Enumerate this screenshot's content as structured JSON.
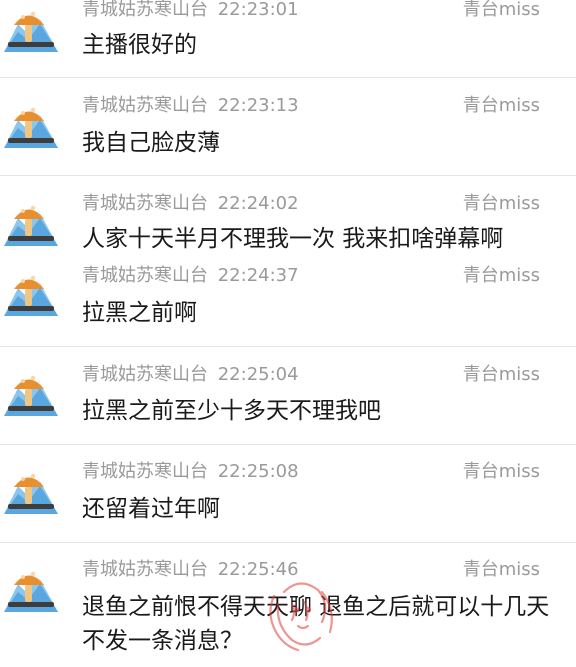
{
  "messages": [
    {
      "sender": "青城姑苏寒山台",
      "time": "22:23:01",
      "recipient": "青台miss",
      "text": "主播很好的"
    },
    {
      "sender": "青城姑苏寒山台",
      "time": "22:23:13",
      "recipient": "青台miss",
      "text": "我自己脸皮薄"
    },
    {
      "sender": "青城姑苏寒山台",
      "time": "22:24:02",
      "recipient": "青台miss",
      "text": "人家十天半月不理我一次 我来扣啥弹幕啊"
    },
    {
      "sender": "青城姑苏寒山台",
      "time": "22:24:37",
      "recipient": "青台miss",
      "text": "拉黑之前啊"
    },
    {
      "sender": "青城姑苏寒山台",
      "time": "22:25:04",
      "recipient": "青台miss",
      "text": "拉黑之前至少十多天不理我吧"
    },
    {
      "sender": "青城姑苏寒山台",
      "time": "22:25:08",
      "recipient": "青台miss",
      "text": "还留着过年啊"
    },
    {
      "sender": "青城姑苏寒山台",
      "time": "22:25:46",
      "recipient": "青台miss",
      "text": "退鱼之前恨不得天天聊 退鱼之后就可以十几天不发一条消息？"
    }
  ],
  "icons": {
    "avatar": "mushroom-mountain-avatar-icon",
    "watermark": "red-portrait-watermark"
  },
  "colors": {
    "meta_text": "#9a9a9a",
    "message_text": "#1a1a1a",
    "divider": "#e4e4e4",
    "avatar_mountain": "#6fb7e8",
    "avatar_mushroom": "#e08a2e",
    "watermark": "#e0403a"
  }
}
